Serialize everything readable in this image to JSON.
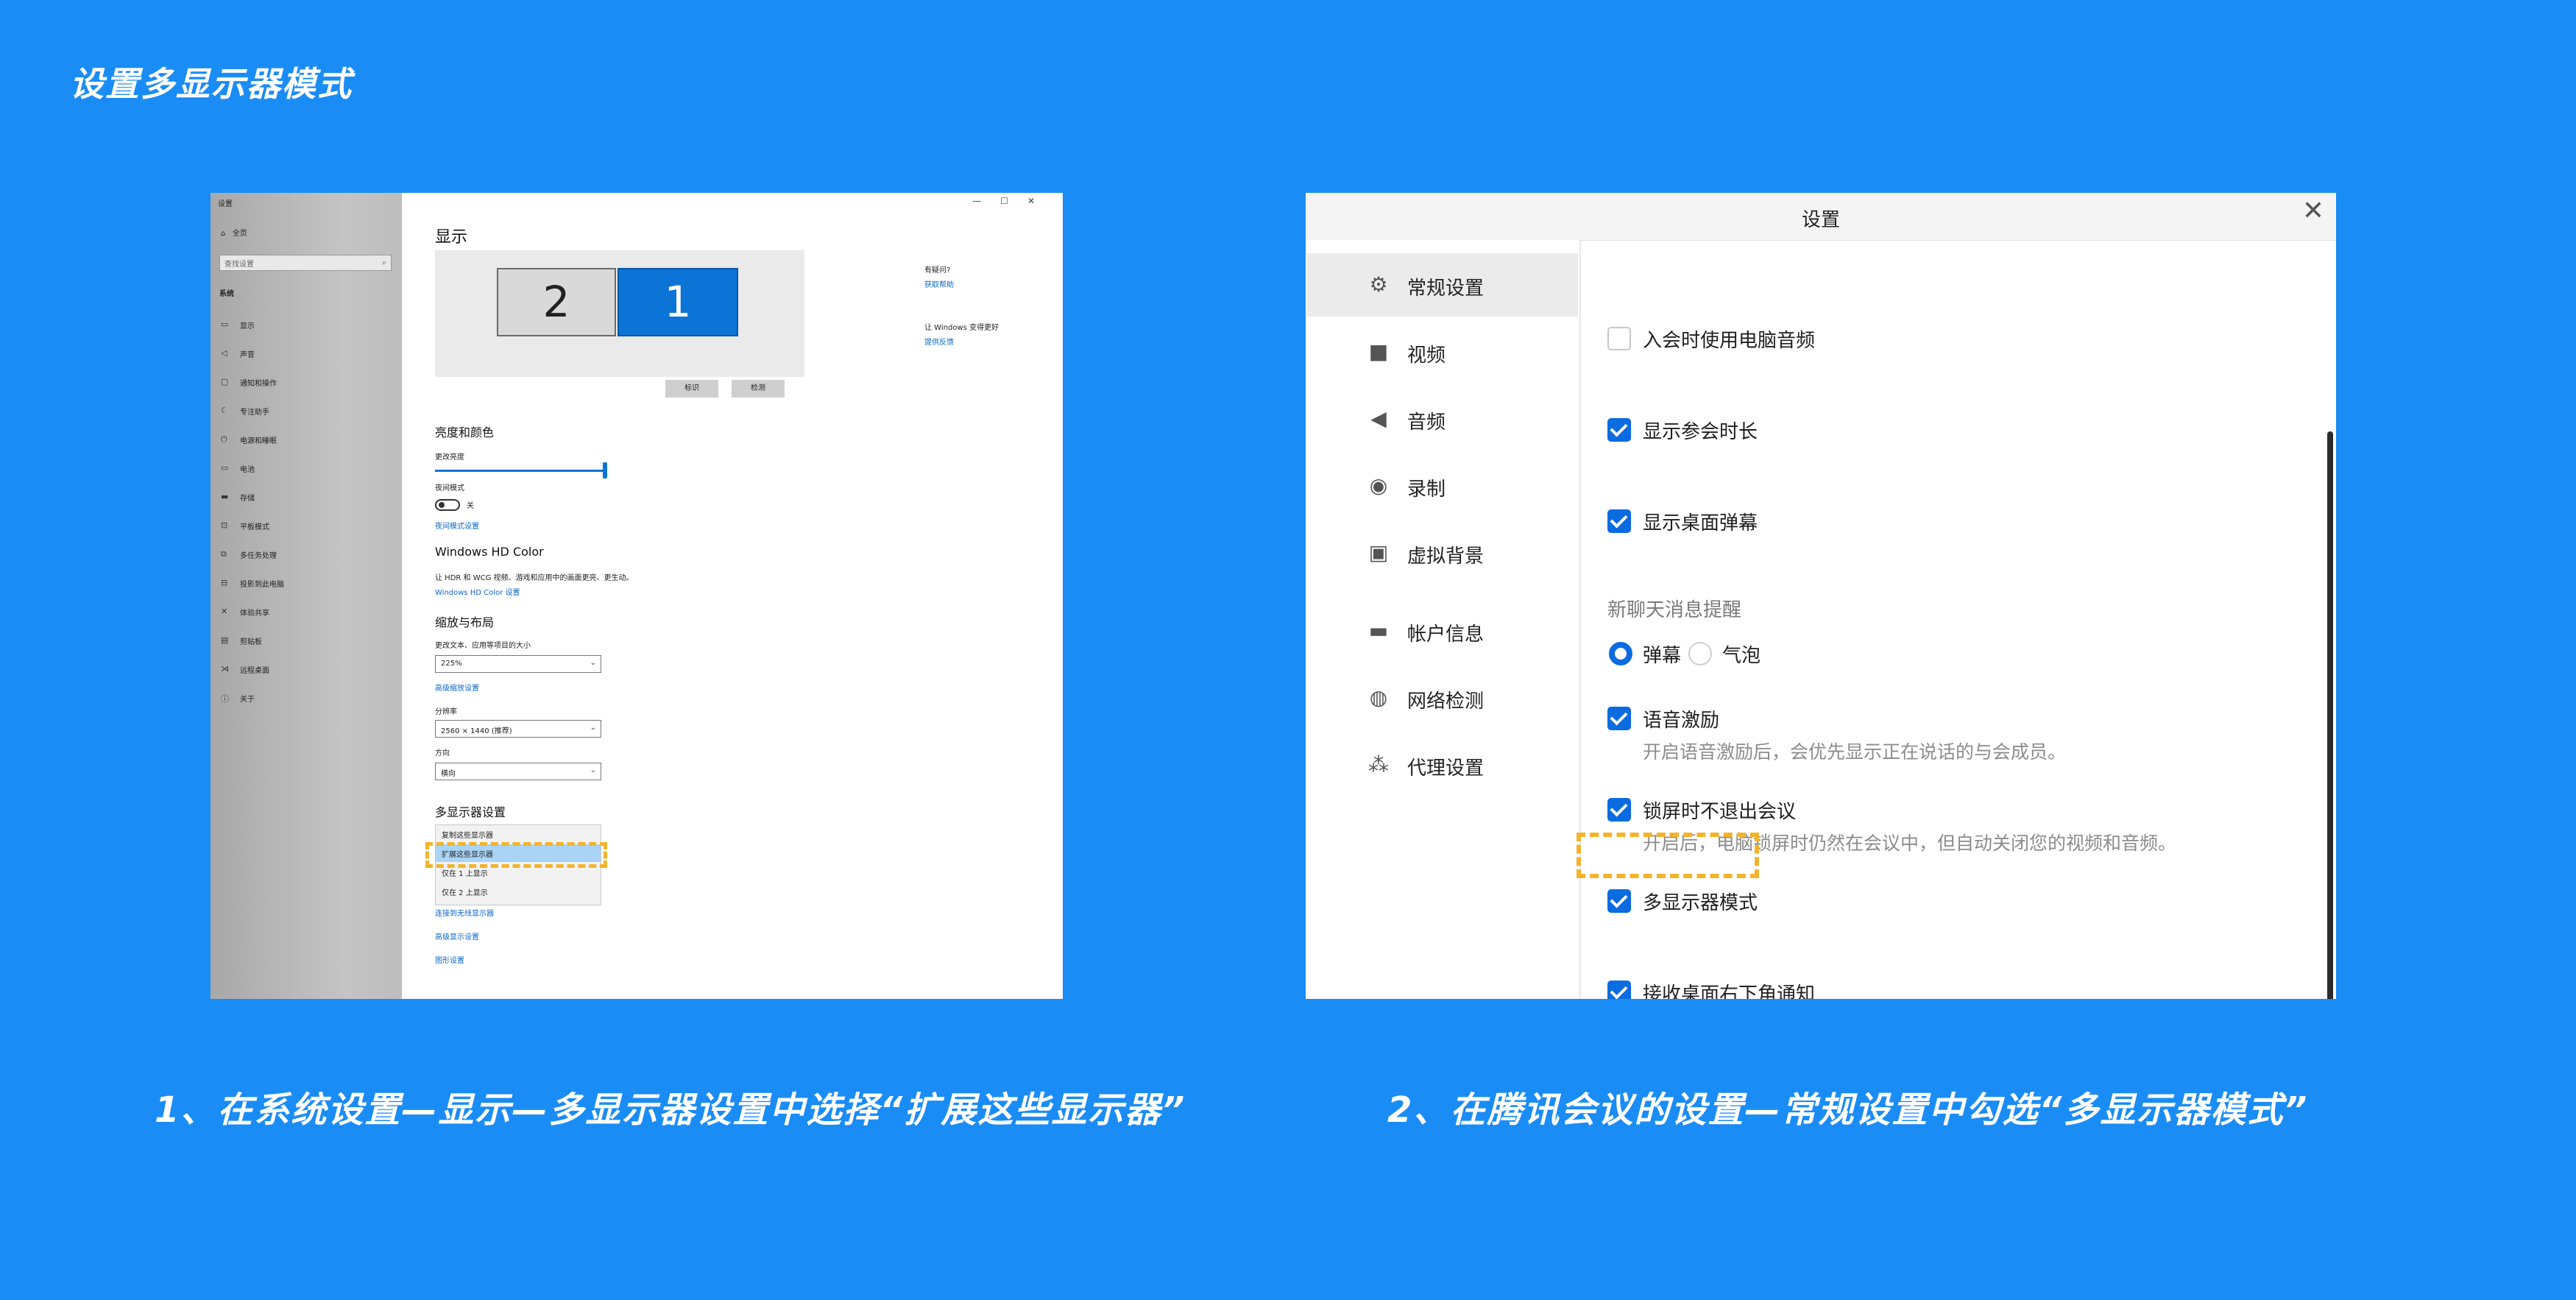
{
  "page": {
    "title": "设置多显示器模式",
    "caption_left": "1、在系统设置—显示—多显示器设置中选择“扩展这些显示器”",
    "caption_right": "2、在腾讯会议的设置—常规设置中勾选“多显示器模式”"
  },
  "colors": {
    "background": "#1a8cf5",
    "accent": "#0b6be0",
    "highlight": "#f3b42c"
  },
  "windows_settings": {
    "window_title": "设置",
    "window_controls": [
      "—",
      "☐",
      "✕"
    ],
    "home": "全页",
    "search_placeholder": "查找设置",
    "group": "系统",
    "nav": [
      {
        "icon": "display-icon",
        "label": "显示"
      },
      {
        "icon": "sound-icon",
        "label": "声音"
      },
      {
        "icon": "notification-icon",
        "label": "通知和操作"
      },
      {
        "icon": "focus-icon",
        "label": "专注助手"
      },
      {
        "icon": "power-icon",
        "label": "电源和睡眠"
      },
      {
        "icon": "battery-icon",
        "label": "电池"
      },
      {
        "icon": "storage-icon",
        "label": "存储"
      },
      {
        "icon": "tablet-icon",
        "label": "平板模式"
      },
      {
        "icon": "multitask-icon",
        "label": "多任务处理"
      },
      {
        "icon": "project-icon",
        "label": "投影到此电脑"
      },
      {
        "icon": "shared-icon",
        "label": "体验共享"
      },
      {
        "icon": "clipboard-icon",
        "label": "剪贴板"
      },
      {
        "icon": "remote-icon",
        "label": "远程桌面"
      },
      {
        "icon": "about-icon",
        "label": "关于"
      }
    ],
    "heading": "显示",
    "monitor_2": "2",
    "monitor_1": "1",
    "identify_btn": "标识",
    "detect_btn": "检测",
    "brightness_section": "亮度和颜色",
    "brightness_label": "更改亮度",
    "brightness_level": 1.0,
    "night_light_label": "夜间模式",
    "night_light_state": "关",
    "night_light_link": "夜间模式设置",
    "hd_color_section": "Windows HD Color",
    "hd_color_desc": "让 HDR 和 WCG 视频、游戏和应用中的画面更亮、更生动。",
    "hd_color_link": "Windows HD Color 设置",
    "scale_section": "缩放与布局",
    "scale_label": "更改文本、应用等项目的大小",
    "scale_value": "225%",
    "advanced_scale_link": "高级缩放设置",
    "resolution_label": "分辨率",
    "resolution_value": "2560 × 1440 (推荐)",
    "orientation_label": "方向",
    "orientation_value": "横向",
    "multi_section": "多显示器设置",
    "multi_options": [
      "复制这些显示器",
      "扩展这些显示器",
      "仅在 1 上显示",
      "仅在 2 上显示"
    ],
    "multi_selected_index": 1,
    "wireless_link": "连接到无线显示器",
    "advanced_display_link": "高级显示设置",
    "graphics_link": "图形设置",
    "help_title": "有疑问?",
    "help_link": "获取帮助",
    "feedback_title": "让 Windows 变得更好",
    "feedback_link": "提供反馈"
  },
  "tencent_settings": {
    "title": "设置",
    "close": "✕",
    "nav": [
      {
        "icon": "gear-icon",
        "glyph": "⚙",
        "label": "常规设置"
      },
      {
        "icon": "video-camera-icon",
        "glyph": "■",
        "label": "视频"
      },
      {
        "icon": "speaker-icon",
        "glyph": "◀",
        "label": "音频"
      },
      {
        "icon": "record-icon",
        "glyph": "◉",
        "label": "录制"
      },
      {
        "icon": "portrait-icon",
        "glyph": "▣",
        "label": "虚拟背景"
      },
      {
        "icon": "card-icon",
        "glyph": "▬",
        "label": "帐户信息"
      },
      {
        "icon": "globe-icon",
        "glyph": "◍",
        "label": "网络检测"
      },
      {
        "icon": "proxy-network-icon",
        "glyph": "⁂",
        "label": "代理设置"
      }
    ],
    "active_nav_index": 0,
    "options": {
      "computer_audio": {
        "label": "入会时使用电脑音频",
        "checked": false
      },
      "show_duration": {
        "label": "显示参会时长",
        "checked": true
      },
      "show_barrage": {
        "label": "显示桌面弹幕",
        "checked": true
      },
      "chat_reminder_title": "新聊天消息提醒",
      "chat_reminder_options": [
        "弹幕",
        "气泡"
      ],
      "chat_reminder_selected": 0,
      "voice_excitation": {
        "label": "语音激励",
        "checked": true,
        "desc": "开启语音激励后，会优先显示正在说话的与会成员。"
      },
      "lock_screen": {
        "label": "锁屏时不退出会议",
        "checked": true,
        "desc": "开启后，电脑锁屏时仍然在会议中，但自动关闭您的视频和音频。"
      },
      "multi_monitor": {
        "label": "多显示器模式",
        "checked": true
      },
      "desktop_notify": {
        "label": "接收桌面右下角通知",
        "checked": true
      }
    }
  }
}
